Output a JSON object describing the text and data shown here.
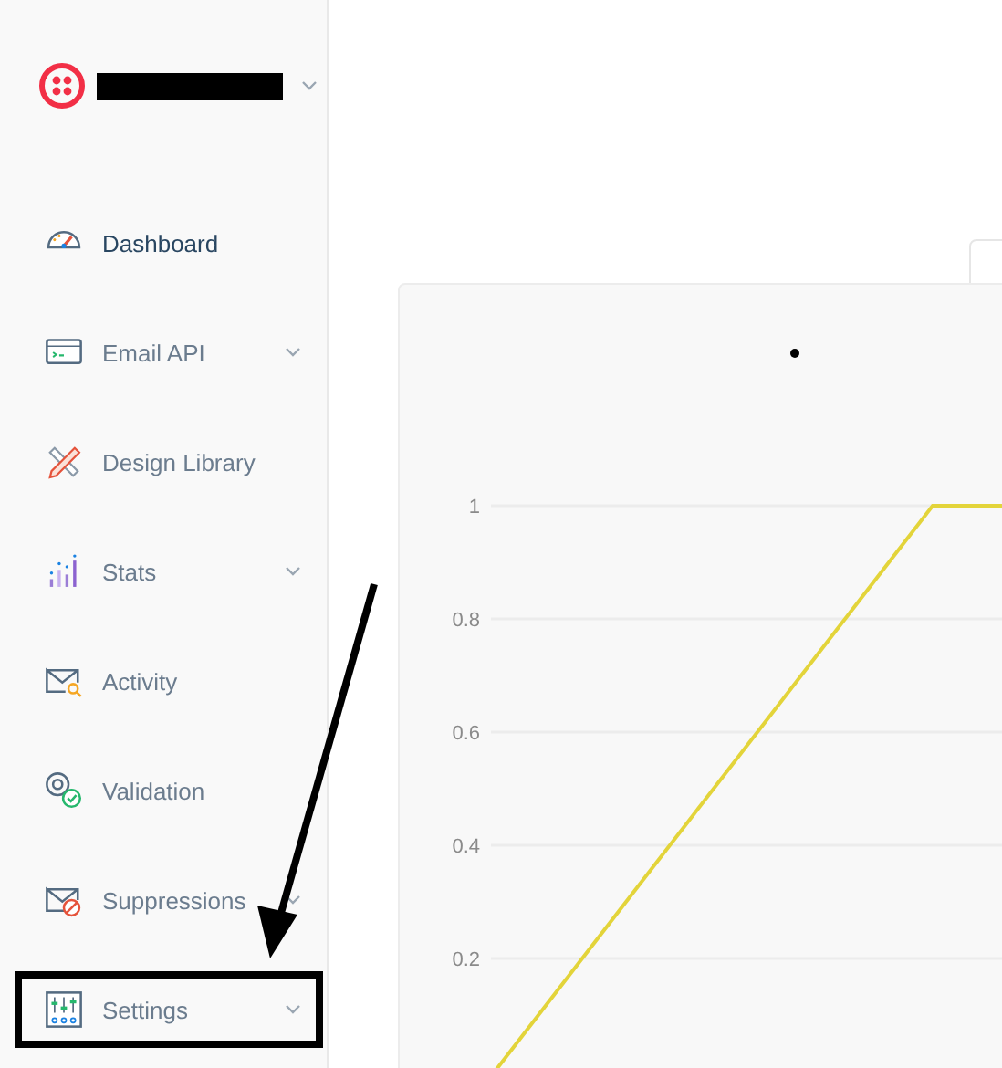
{
  "sidebar": {
    "account": {
      "name_redacted": true
    },
    "items": [
      {
        "label": "Dashboard",
        "selected": true,
        "has_submenu": false,
        "annotated": false
      },
      {
        "label": "Email API",
        "selected": false,
        "has_submenu": true,
        "annotated": false
      },
      {
        "label": "Design Library",
        "selected": false,
        "has_submenu": false,
        "annotated": false
      },
      {
        "label": "Stats",
        "selected": false,
        "has_submenu": true,
        "annotated": false
      },
      {
        "label": "Activity",
        "selected": false,
        "has_submenu": false,
        "annotated": false
      },
      {
        "label": "Validation",
        "selected": false,
        "has_submenu": false,
        "annotated": false
      },
      {
        "label": "Suppressions",
        "selected": false,
        "has_submenu": true,
        "annotated": false
      },
      {
        "label": "Settings",
        "selected": false,
        "has_submenu": true,
        "annotated": true
      }
    ]
  },
  "chart_card": {
    "y_axis_labels": [
      "1",
      "0.8",
      "0.6",
      "0.4",
      "0.2"
    ]
  }
}
